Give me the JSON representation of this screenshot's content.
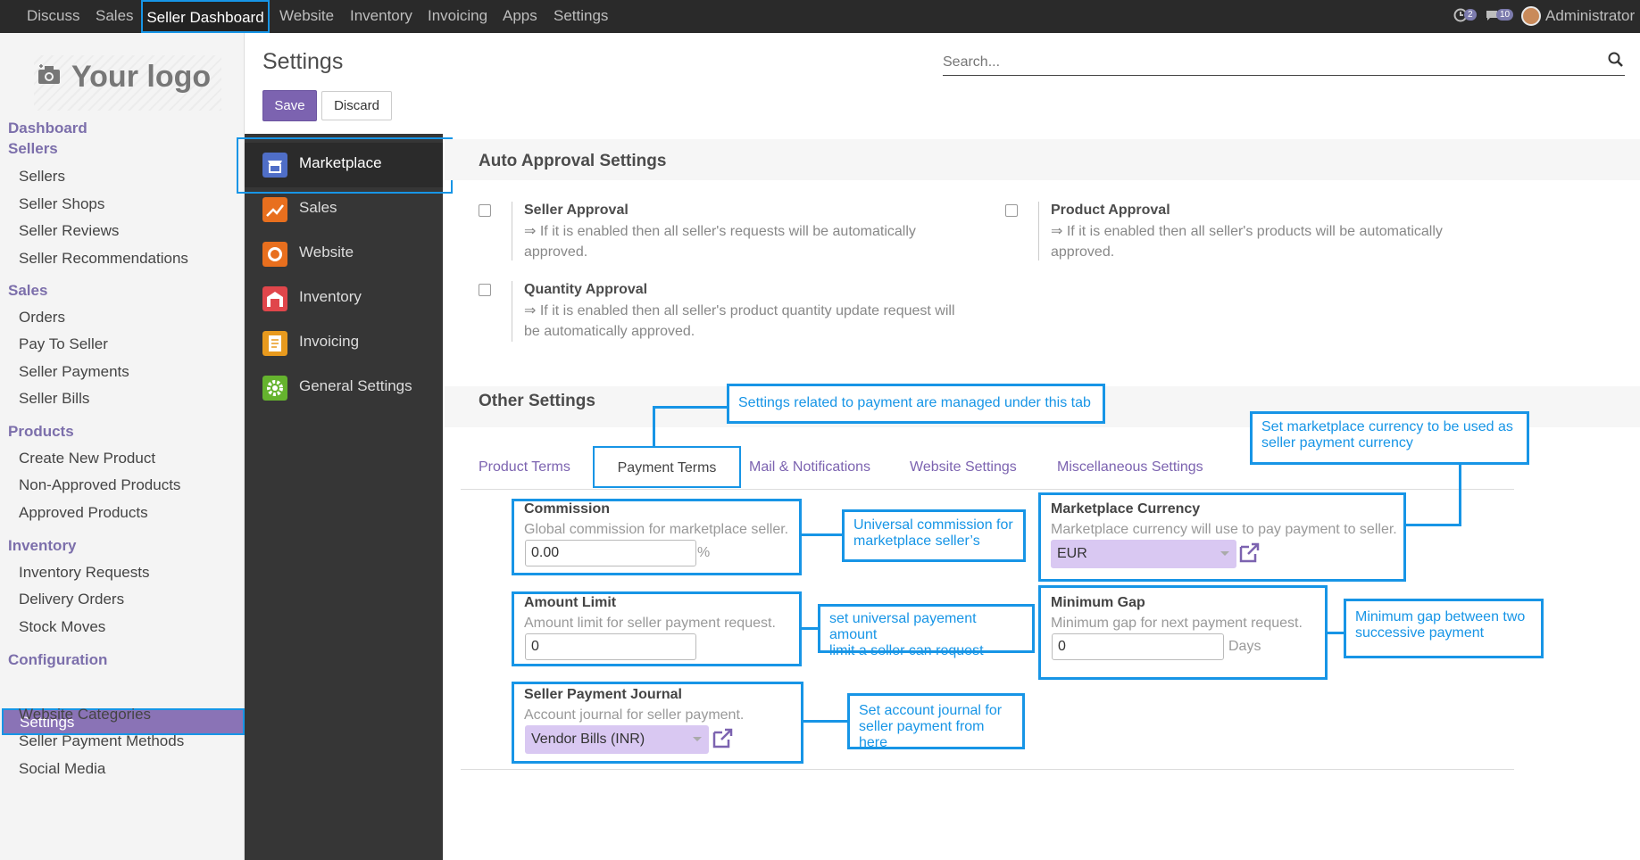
{
  "topbar": {
    "menu": [
      "Discuss",
      "Sales",
      "Seller Dashboard",
      "Website",
      "Inventory",
      "Invoicing",
      "Apps",
      "Settings"
    ],
    "badges": {
      "activity": "2",
      "messages": "10"
    },
    "user": "Administrator"
  },
  "sidebar": {
    "logo": "Your logo",
    "sections": [
      {
        "title": "Dashboard"
      },
      {
        "title": "Sellers",
        "items": [
          "Sellers",
          "Seller Shops",
          "Seller Reviews",
          "Seller Recommendations"
        ]
      },
      {
        "title": "Sales",
        "items": [
          "Orders",
          "Pay To Seller",
          "Seller Payments",
          "Seller Bills"
        ]
      },
      {
        "title": "Products",
        "items": [
          "Create New Product",
          "Non-Approved Products",
          "Approved Products"
        ]
      },
      {
        "title": "Inventory",
        "items": [
          "Inventory Requests",
          "Delivery Orders",
          "Stock Moves"
        ]
      },
      {
        "title": "Configuration",
        "items": [
          "Settings",
          "Website Categories",
          "Seller Payment Methods",
          "Social Media"
        ]
      }
    ]
  },
  "control": {
    "title": "Settings",
    "save": "Save",
    "discard": "Discard",
    "search_placeholder": "Search..."
  },
  "apps": [
    "Marketplace",
    "Sales",
    "Website",
    "Inventory",
    "Invoicing",
    "General Settings"
  ],
  "auto_approval": {
    "title": "Auto Approval Settings",
    "options": [
      {
        "title": "Seller Approval",
        "desc1": "⇒ If it is enabled then all seller's requests will be automatically",
        "desc2": "approved."
      },
      {
        "title": "Product Approval",
        "desc1": "⇒ If it is enabled then all seller's products will be automatically",
        "desc2": "approved."
      },
      {
        "title": "Quantity Approval",
        "desc1": "⇒ If it is enabled then all seller's product quantity update request will",
        "desc2": "be automatically approved."
      }
    ]
  },
  "other": {
    "title": "Other Settings",
    "tabs": [
      "Product Terms",
      "Payment Terms",
      "Mail & Notifications",
      "Website Settings",
      "Miscellaneous Settings"
    ]
  },
  "fields": {
    "commission": {
      "title": "Commission",
      "desc": "Global commission for marketplace seller.",
      "value": "0.00",
      "suffix": "%"
    },
    "currency": {
      "title": "Marketplace Currency",
      "desc": "Marketplace currency will use to pay payment to seller.",
      "value": "EUR"
    },
    "amount_limit": {
      "title": "Amount Limit",
      "desc": "Amount limit for seller payment request.",
      "value": "0"
    },
    "min_gap": {
      "title": "Minimum Gap",
      "desc": "Minimum gap for next payment request.",
      "value": "0",
      "suffix": "Days"
    },
    "journal": {
      "title": "Seller Payment Journal",
      "desc": "Account journal for seller payment.",
      "value": "Vendor Bills (INR)"
    }
  },
  "callouts": {
    "tab_note": "Settings related to payment are managed under this tab",
    "currency_note1": "Set marketplace currency to be used as",
    "currency_note2": "seller payment currency",
    "commission_note1": "Universal commission for",
    "commission_note2": "marketplace seller’s",
    "limit_note1": "set universal payement amount",
    "limit_note2": "limit a seller can request",
    "gap_note1": "Minimum gap between two",
    "gap_note2": "successive payment",
    "journal_note1": "Set account journal for",
    "journal_note2": "seller payment from here"
  },
  "colors": {
    "accent": "#7c63b0",
    "highlight": "#1795e6",
    "topbar": "#2a2a2a",
    "app_panel": "#363636"
  }
}
